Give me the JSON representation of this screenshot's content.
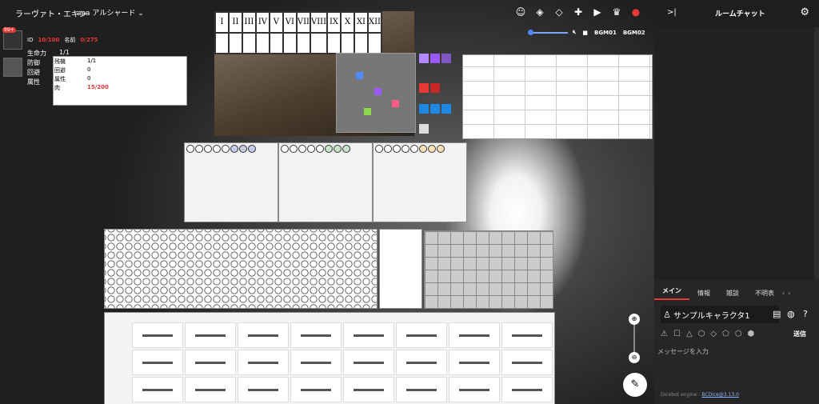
{
  "topbar": {
    "room_name": "ラーヴァト・エキン",
    "char_select": "aaa アルシャード",
    "bgm1": "BGM01",
    "bgm2": "BGM02"
  },
  "characters": [
    {
      "badge": "99+",
      "labels": [
        "ID",
        "名前"
      ],
      "hp": "10/100",
      "mp": "0/275"
    },
    {
      "labels": [
        "生命力",
        "防御",
        "回避",
        "属性",
        "肉"
      ],
      "values": [
        "1/1",
        "0",
        "0",
        "0",
        "15/200"
      ],
      "labels2": [
        "残機",
        "回避",
        "属性"
      ],
      "values2": [
        "1/1",
        "0",
        "0"
      ]
    }
  ],
  "roman_numerals": [
    "I",
    "II",
    "III",
    "IV",
    "V",
    "VI",
    "VII",
    "VIII",
    "IX",
    "X",
    "XI",
    "XII"
  ],
  "colors": {
    "accent": "#e53935",
    "blue": "#4d8bff",
    "purple": "#9b59f5"
  },
  "chat": {
    "title": "ルームチャット",
    "tabs": [
      "メイン",
      "情報",
      "雑談",
      "不明表"
    ],
    "character_name": "サンプルキャラクタ1",
    "send": "送信",
    "placeholder": "メッセージを入力",
    "engine_label": "Dicebot engine : ",
    "engine_link": "BCDice@3.13.0"
  }
}
